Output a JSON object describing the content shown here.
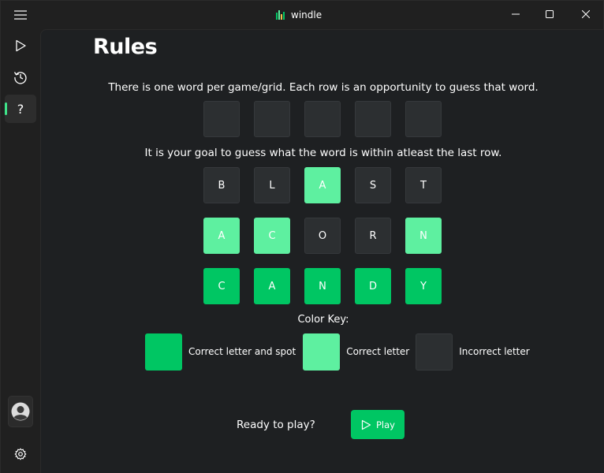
{
  "app": {
    "title": "windle"
  },
  "page": {
    "title": "Rules"
  },
  "rules": {
    "line1": "There is one word per game/grid. Each row is an opportunity to guess that word.",
    "line2": "It is your goal to guess what the word is within atleast the last row.",
    "color_key_title": "Color Key:"
  },
  "example_rows": [
    {
      "letters": [
        "B",
        "L",
        "A",
        "S",
        "T"
      ],
      "states": [
        "incorrect",
        "incorrect",
        "correct-letter",
        "incorrect",
        "incorrect"
      ]
    },
    {
      "letters": [
        "A",
        "C",
        "O",
        "R",
        "N"
      ],
      "states": [
        "correct-letter",
        "correct-letter",
        "incorrect",
        "incorrect",
        "correct-letter"
      ]
    },
    {
      "letters": [
        "C",
        "A",
        "N",
        "D",
        "Y"
      ],
      "states": [
        "correct-spot",
        "correct-spot",
        "correct-spot",
        "correct-spot",
        "correct-spot"
      ]
    }
  ],
  "color_key": [
    {
      "label": "Correct letter and spot",
      "color": "#00c663"
    },
    {
      "label": "Correct letter",
      "color": "#5ef0a0"
    },
    {
      "label": "Incorrect letter",
      "color": "#2c2f31"
    }
  ],
  "footer": {
    "ready_text": "Ready to play?",
    "play_label": "Play"
  },
  "colors": {
    "correct_spot": "#00c663",
    "correct_letter": "#5ef0a0",
    "incorrect": "#2c2f31",
    "accent": "#3fe38a"
  },
  "icons": {
    "menu": "hamburger-icon",
    "play": "play-icon",
    "history": "history-icon",
    "help": "question-icon",
    "account": "person-icon",
    "settings": "gear-icon"
  }
}
